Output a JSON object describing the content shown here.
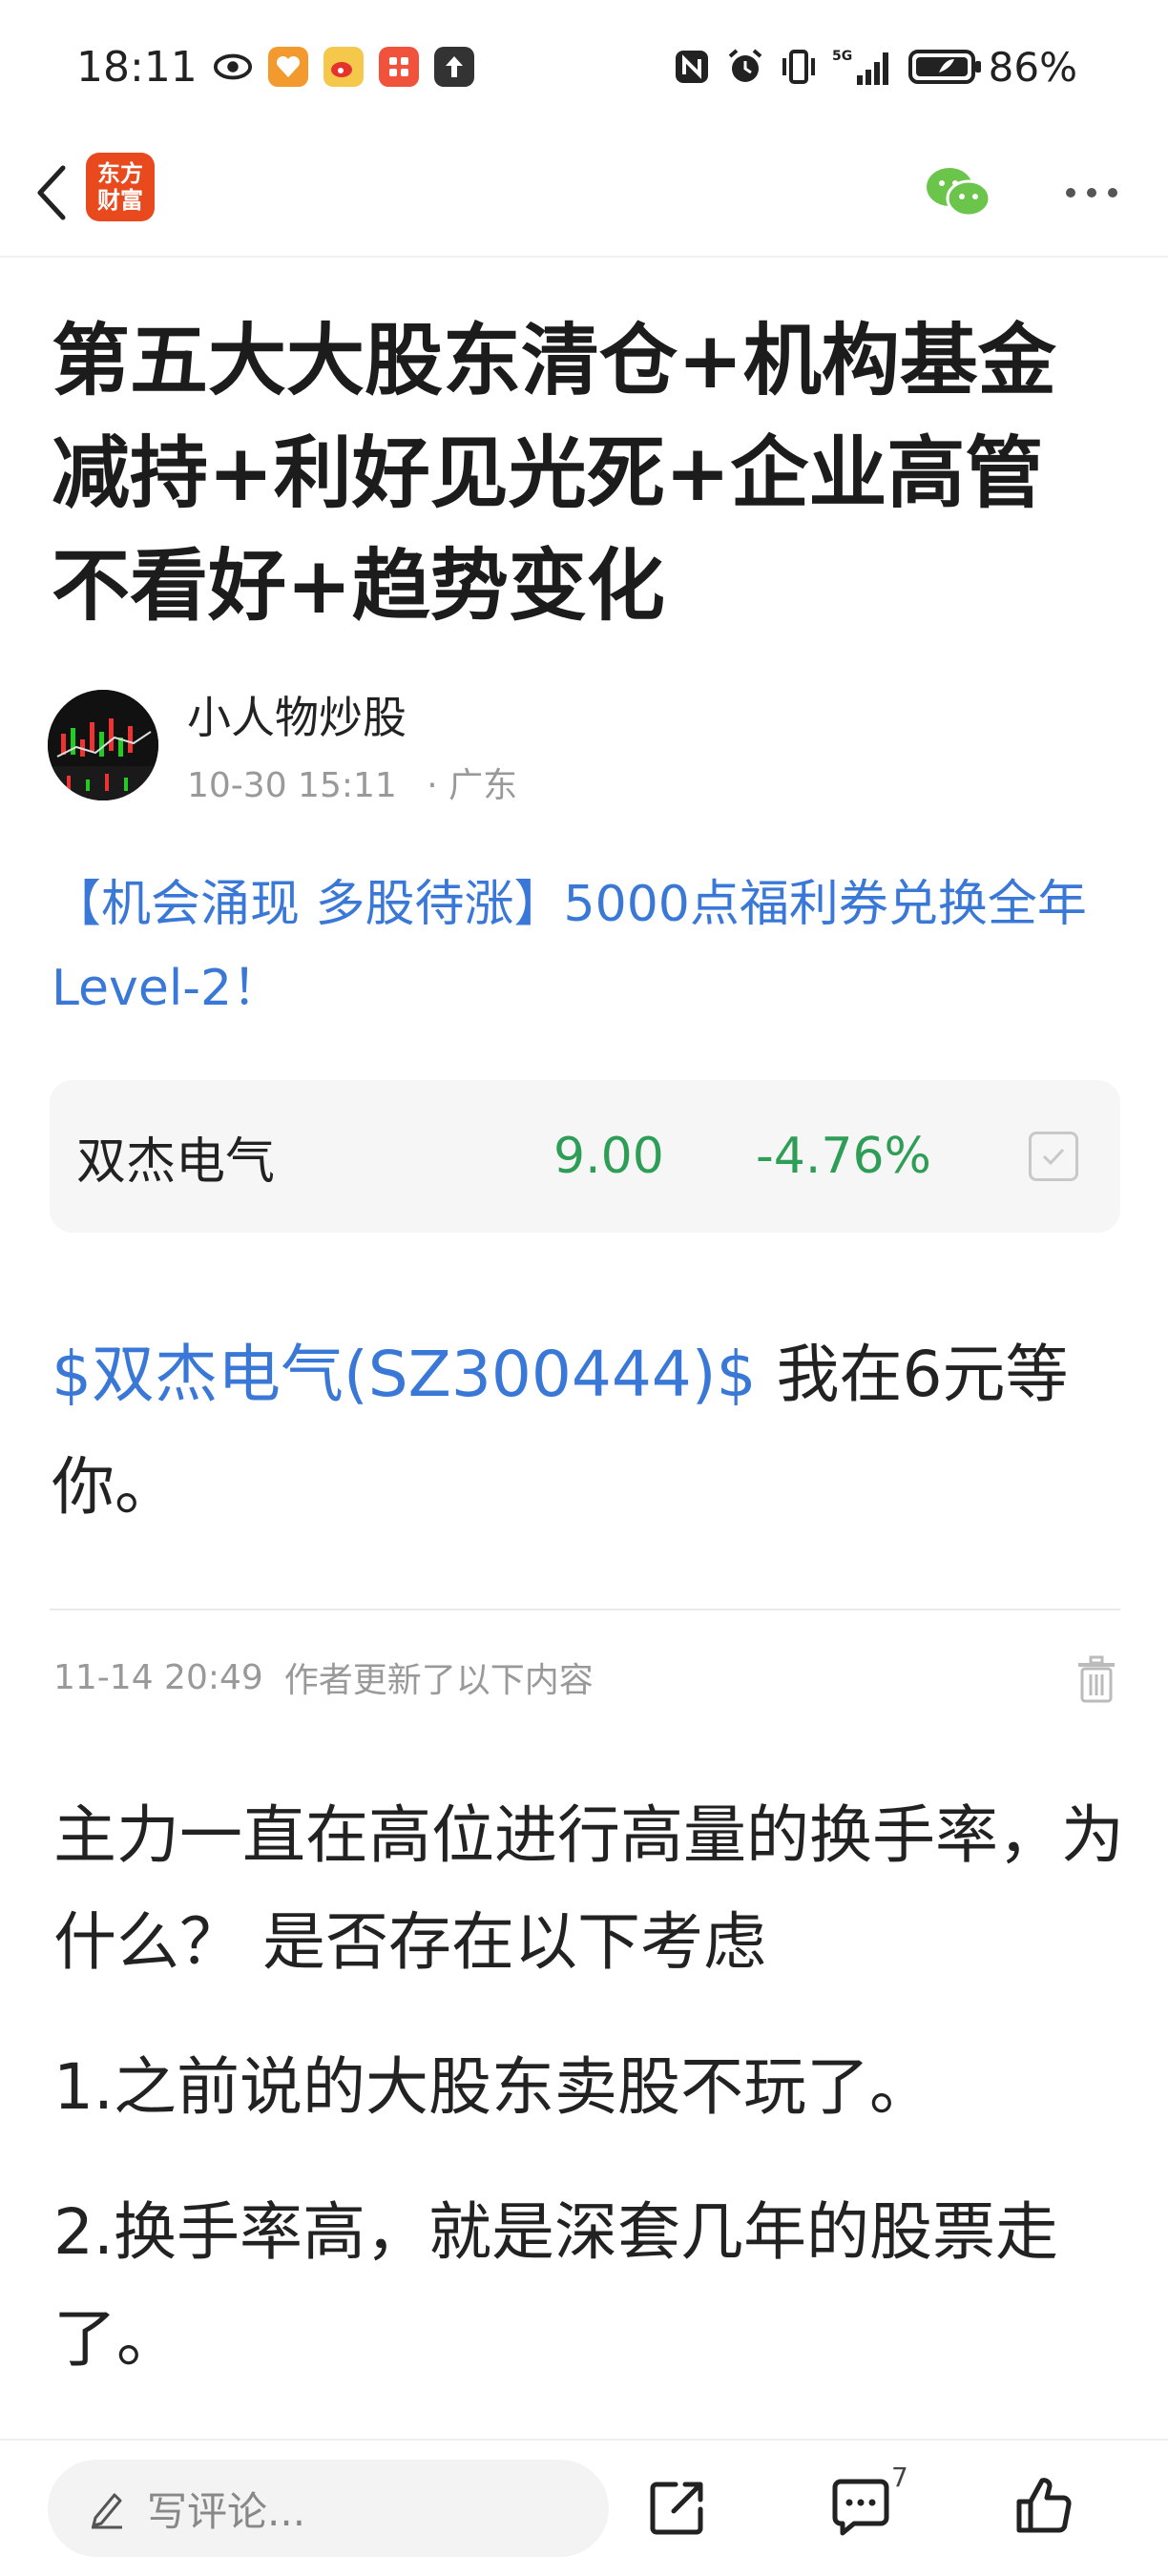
{
  "status_bar": {
    "time": "18:11",
    "network": "5G",
    "battery": "86%",
    "icons": [
      "eye-icon",
      "app-notify-orange-icon",
      "weibo-icon",
      "app-notify-red-icon",
      "upload-icon",
      "nfc-icon",
      "alarm-icon",
      "vibrate-icon",
      "signal-icon",
      "battery-icon"
    ]
  },
  "app_bar": {
    "logo_line1": "东方",
    "logo_line2": "财富",
    "icons": [
      "back-icon",
      "wechat-icon",
      "more-icon"
    ]
  },
  "article": {
    "title": "第五大大股东清仓+机构基金减持+利好见光死+企业高管不看好+趋势变化",
    "author": "小人物炒股",
    "post_time": "10-30 15:11",
    "location": "· 广东",
    "promo": "【机会涌现 多股待涨】5000点福利券兑换全年Level-2！"
  },
  "stock_card": {
    "name": "双杰电气",
    "price": "9.00",
    "change": "-4.76%",
    "colors": {
      "down": "#2e9e57"
    }
  },
  "body": {
    "stock_link": "$双杰电气(SZ300444)$",
    "text": " 我在6元等你。",
    "update_time": "11-14 20:49",
    "update_note": "作者更新了以下内容",
    "paragraphs": [
      "主力一直在高位进行高量的换手率，为什么？ 是否存在以下考虑",
      "1.之前说的大股东卖股不玩了。",
      "2.换手率高，就是深套几年的股票走了。"
    ]
  },
  "bottom_bar": {
    "comment_placeholder": "写评论...",
    "comment_count": "7",
    "icons": [
      "pencil-icon",
      "share-icon",
      "comment-icon",
      "thumbs-up-icon"
    ]
  },
  "colors": {
    "link": "#3a78d8",
    "brand": "#e8491d",
    "wechat": "#6bc54b"
  }
}
